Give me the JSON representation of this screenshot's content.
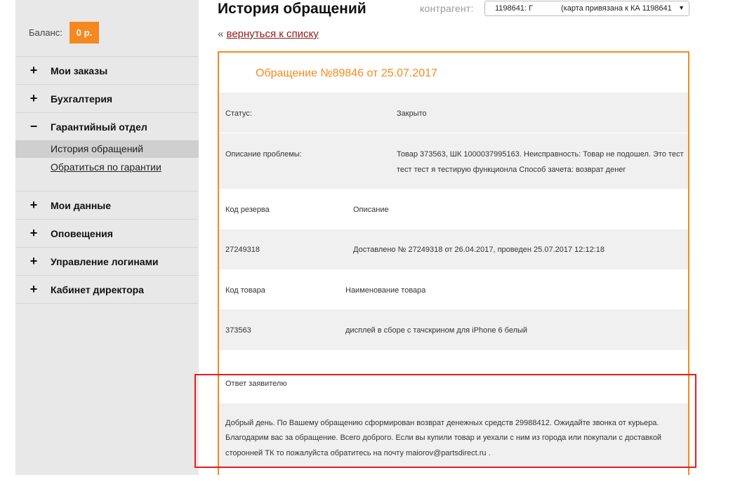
{
  "sidebar": {
    "balance_label": "Баланс:",
    "balance_value": "0 р.",
    "menu": [
      {
        "sign": "+",
        "label": "Мои заказы"
      },
      {
        "sign": "+",
        "label": "Бухгалтерия"
      },
      {
        "sign": "−",
        "label": "Гарантийный отдел"
      }
    ],
    "submenu": {
      "active": "История обращений",
      "link": "Обратиться по гарантии"
    },
    "menu_after": [
      {
        "sign": "+",
        "label": "Мои данные"
      },
      {
        "sign": "+",
        "label": "Оповещения"
      },
      {
        "sign": "+",
        "label": "Управление логинами"
      },
      {
        "sign": "+",
        "label": "Кабинет директора"
      }
    ]
  },
  "header": {
    "title": "История обращений",
    "contragent_label": "контрагент:",
    "contragent_value_code": "1198641: Г",
    "contragent_value_card": "(карта привязана к КА 1198641",
    "contragent_arrow": "▼"
  },
  "back": {
    "prefix": "«",
    "link": "вернуться к списку"
  },
  "ticket": {
    "title": "Обращение №89846 от 25.07.2017",
    "status_label": "Статус:",
    "status_value": "Закрыто",
    "problem_label": "Описание проблемы:",
    "problem_value_line1": "Товар 373563, ШК 1000037995163. Неисправность: Товар не подошел. Это тест",
    "problem_value_line2": "тест тест я тестирую функционла Способ зачета: возврат денег",
    "reserve_header_code": "Код резерва",
    "reserve_header_desc": "Описание",
    "reserve_code": "27249318",
    "reserve_desc": "Доставлено № 27249318 от 26.04.2017, проведен 25.07.2017 12:12:18",
    "product_header_code": "Код товара",
    "product_header_name": "Наименование товара",
    "product_code": "373563",
    "product_name": "дисплей в сборе с тачскрином для iPhone 6 белый",
    "answer_label": "Ответ заявителю",
    "answer_line1": "Добрый день. По Вашему обращению сформирован возврат денежных средств 29988412. Ожидайте звонка от курьера.",
    "answer_line2": "Благодарим вас за обращение. Всего доброго. Если вы купили товар и уехали с ним из города или покупали с доставкой",
    "answer_line3": "сторонней ТК то пожалуйста обратитесь на почту maiorov@partsdirect.ru ."
  }
}
